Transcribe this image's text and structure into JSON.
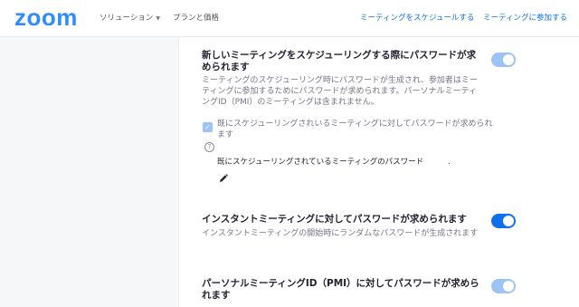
{
  "header": {
    "logo": "zoom",
    "nav": {
      "solutions": "ソリューション",
      "plans": "プランと価格"
    },
    "actions": {
      "schedule": "ミーティングをスケジュールする",
      "join": "ミーティングに参加する"
    }
  },
  "settings": {
    "schedule_password": {
      "title": "新しいミーティングをスケジューリングする際にパスワードが求められます",
      "description": "ミーティングのスケジューリング時にパスワードが生成され、参加者はミーティングに参加するためにパスワードが求められます。パーソナルミーティングID（PMI）のミーティングは含まれません。",
      "enabled": true,
      "toggle_state": "disabled-on"
    },
    "existing_meetings": {
      "checkbox_label": "既にスケジューリングされいるミーティングに対してパスワードが求められます",
      "checked": true,
      "password_label": "既にスケジューリングされているミーティングのパスワード",
      "password_value": "."
    },
    "instant_password": {
      "title": "インスタントミーティングに対してパスワードが求められます",
      "description": "インスタントミーティングの開始時にランダムなパスワードが生成されます",
      "enabled": true,
      "toggle_state": "on"
    },
    "pmi_password": {
      "title": "パーソナルミーティングID（PMI）に対してパスワードが求められます",
      "enabled": true,
      "toggle_state": "disabled-on"
    }
  },
  "colors": {
    "brand": "#2d8cff",
    "link": "#0e71eb",
    "toggle_on": "#0e71eb",
    "toggle_disabled": "#9dc3f5"
  },
  "icons": {
    "checkbox": "check-icon",
    "help": "question-circle-icon",
    "edit": "pencil-icon",
    "nav_dropdown": "chevron-down-icon"
  }
}
